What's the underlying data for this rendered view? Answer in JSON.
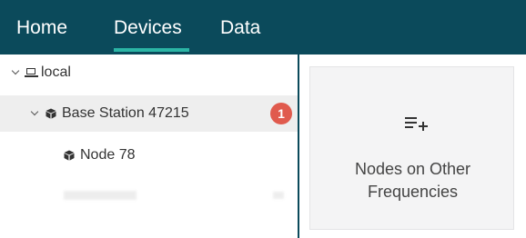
{
  "nav": {
    "tabs": [
      {
        "label": "Home"
      },
      {
        "label": "Devices",
        "active": true
      },
      {
        "label": "Data"
      }
    ]
  },
  "tree": {
    "root": {
      "label": "local",
      "icon": "laptop-icon",
      "expanded": true
    },
    "station": {
      "label": "Base Station 47215",
      "icon": "cube-icon",
      "expanded": true,
      "badge": "1"
    },
    "node": {
      "label": "Node 78",
      "icon": "cube-icon"
    }
  },
  "panel": {
    "icon": "playlist-add-icon",
    "line1": "Nodes on Other",
    "line2": "Frequencies"
  },
  "colors": {
    "nav_bg": "#0b4a5b",
    "accent": "#2bb5a5",
    "badge": "#e05a4d",
    "selected_row": "#eeeeee"
  }
}
